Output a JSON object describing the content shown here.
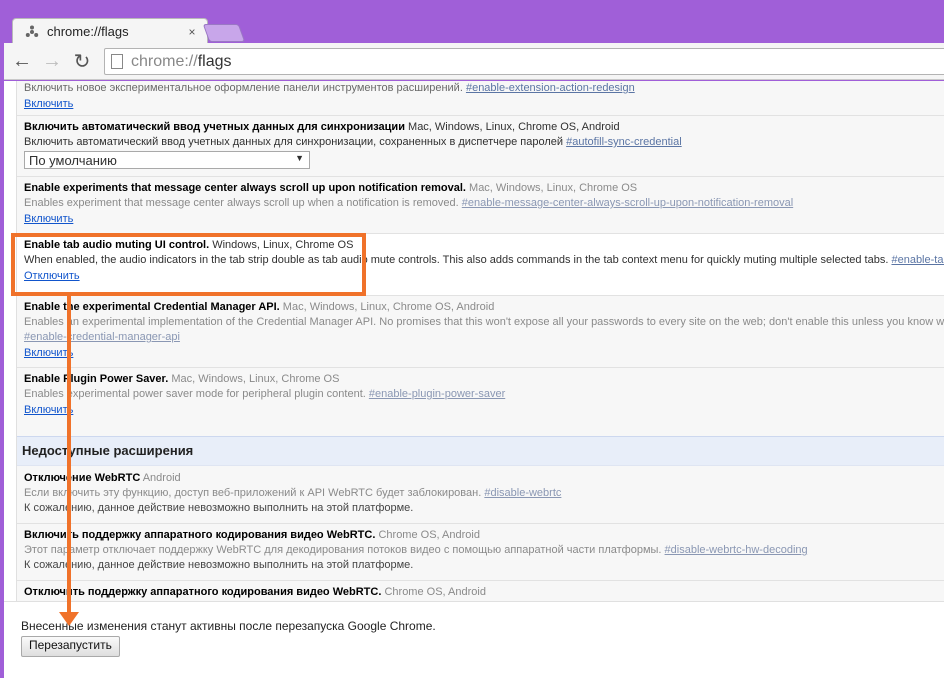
{
  "browser": {
    "tab_title": "chrome://flags",
    "tab_close": "×",
    "url_scheme": "chrome://",
    "url_path": "flags",
    "back": "←",
    "forward": "→",
    "reload": "↻"
  },
  "experiments": [
    {
      "desc": "Включить новое экспериментальное оформление панели инструментов расширений.",
      "hash": "#enable-extension-action-redesign",
      "link": "Включить"
    },
    {
      "name": "Включить автоматический ввод учетных данных для синхронизации",
      "platforms": "Mac, Windows, Linux, Chrome OS, Android",
      "desc": "Включить автоматический ввод учетных данных для синхронизации, сохраненных в диспетчере паролей",
      "hash": "#autofill-sync-credential",
      "select_value": "По умолчанию"
    },
    {
      "name": "Enable experiments that message center always scroll up upon notification removal.",
      "platforms": "Mac, Windows, Linux, Chrome OS",
      "desc": "Enables experiment that message center always scroll up when a notification is removed.",
      "hash": "#enable-message-center-always-scroll-up-upon-notification-removal",
      "link": "Включить"
    },
    {
      "name": "Enable tab audio muting UI control.",
      "platforms": "Windows, Linux, Chrome OS",
      "desc": "When enabled, the audio indicators in the tab strip double as tab audio mute controls. This also adds commands in the tab context menu for quickly muting multiple selected tabs.",
      "hash": "#enable-tab-audio-muting",
      "link": "Отключить"
    },
    {
      "name": "Enable the experimental Credential Manager API.",
      "platforms": "Mac, Windows, Linux, Chrome OS, Android",
      "desc": "Enables an experimental implementation of the Credential Manager API. No promises that this won't expose all your passwords to every site on the web; don't enable this unless you know what you're doing.",
      "hash": "#enable-credential-manager-api",
      "link": "Включить"
    },
    {
      "name": "Enable Plugin Power Saver.",
      "platforms": "Mac, Windows, Linux, Chrome OS",
      "desc": "Enables experimental power saver mode for peripheral plugin content.",
      "hash": "#enable-plugin-power-saver",
      "link": "Включить"
    }
  ],
  "unavailable": {
    "heading": "Недоступные расширения",
    "items": [
      {
        "name": "Отключение WebRTC",
        "platforms": "Android",
        "desc": "Если включить эту функцию, доступ веб-приложений к API WebRTC будет заблокирован.",
        "hash": "#disable-webrtc",
        "note": "К сожалению, данное действие невозможно выполнить на этой платформе."
      },
      {
        "name": "Включить поддержку аппаратного кодирования видео WebRTC.",
        "platforms": "Chrome OS, Android",
        "desc": "Этот параметр отключает поддержку WebRTC для декодирования потоков видео с помощью аппаратной части платформы.",
        "hash": "#disable-webrtc-hw-decoding",
        "note": "К сожалению, данное действие невозможно выполнить на этой платформе."
      },
      {
        "name": "Отключить поддержку аппаратного кодирования видео WebRTC.",
        "platforms": "Chrome OS, Android"
      }
    ]
  },
  "footer": {
    "message": "Внесенные изменения станут активны после перезапуска Google Chrome.",
    "relaunch_button": "Перезапустить"
  },
  "colors": {
    "annotation": "#f0722a",
    "window_frame": "#a05fd8",
    "link": "#1155cc"
  }
}
